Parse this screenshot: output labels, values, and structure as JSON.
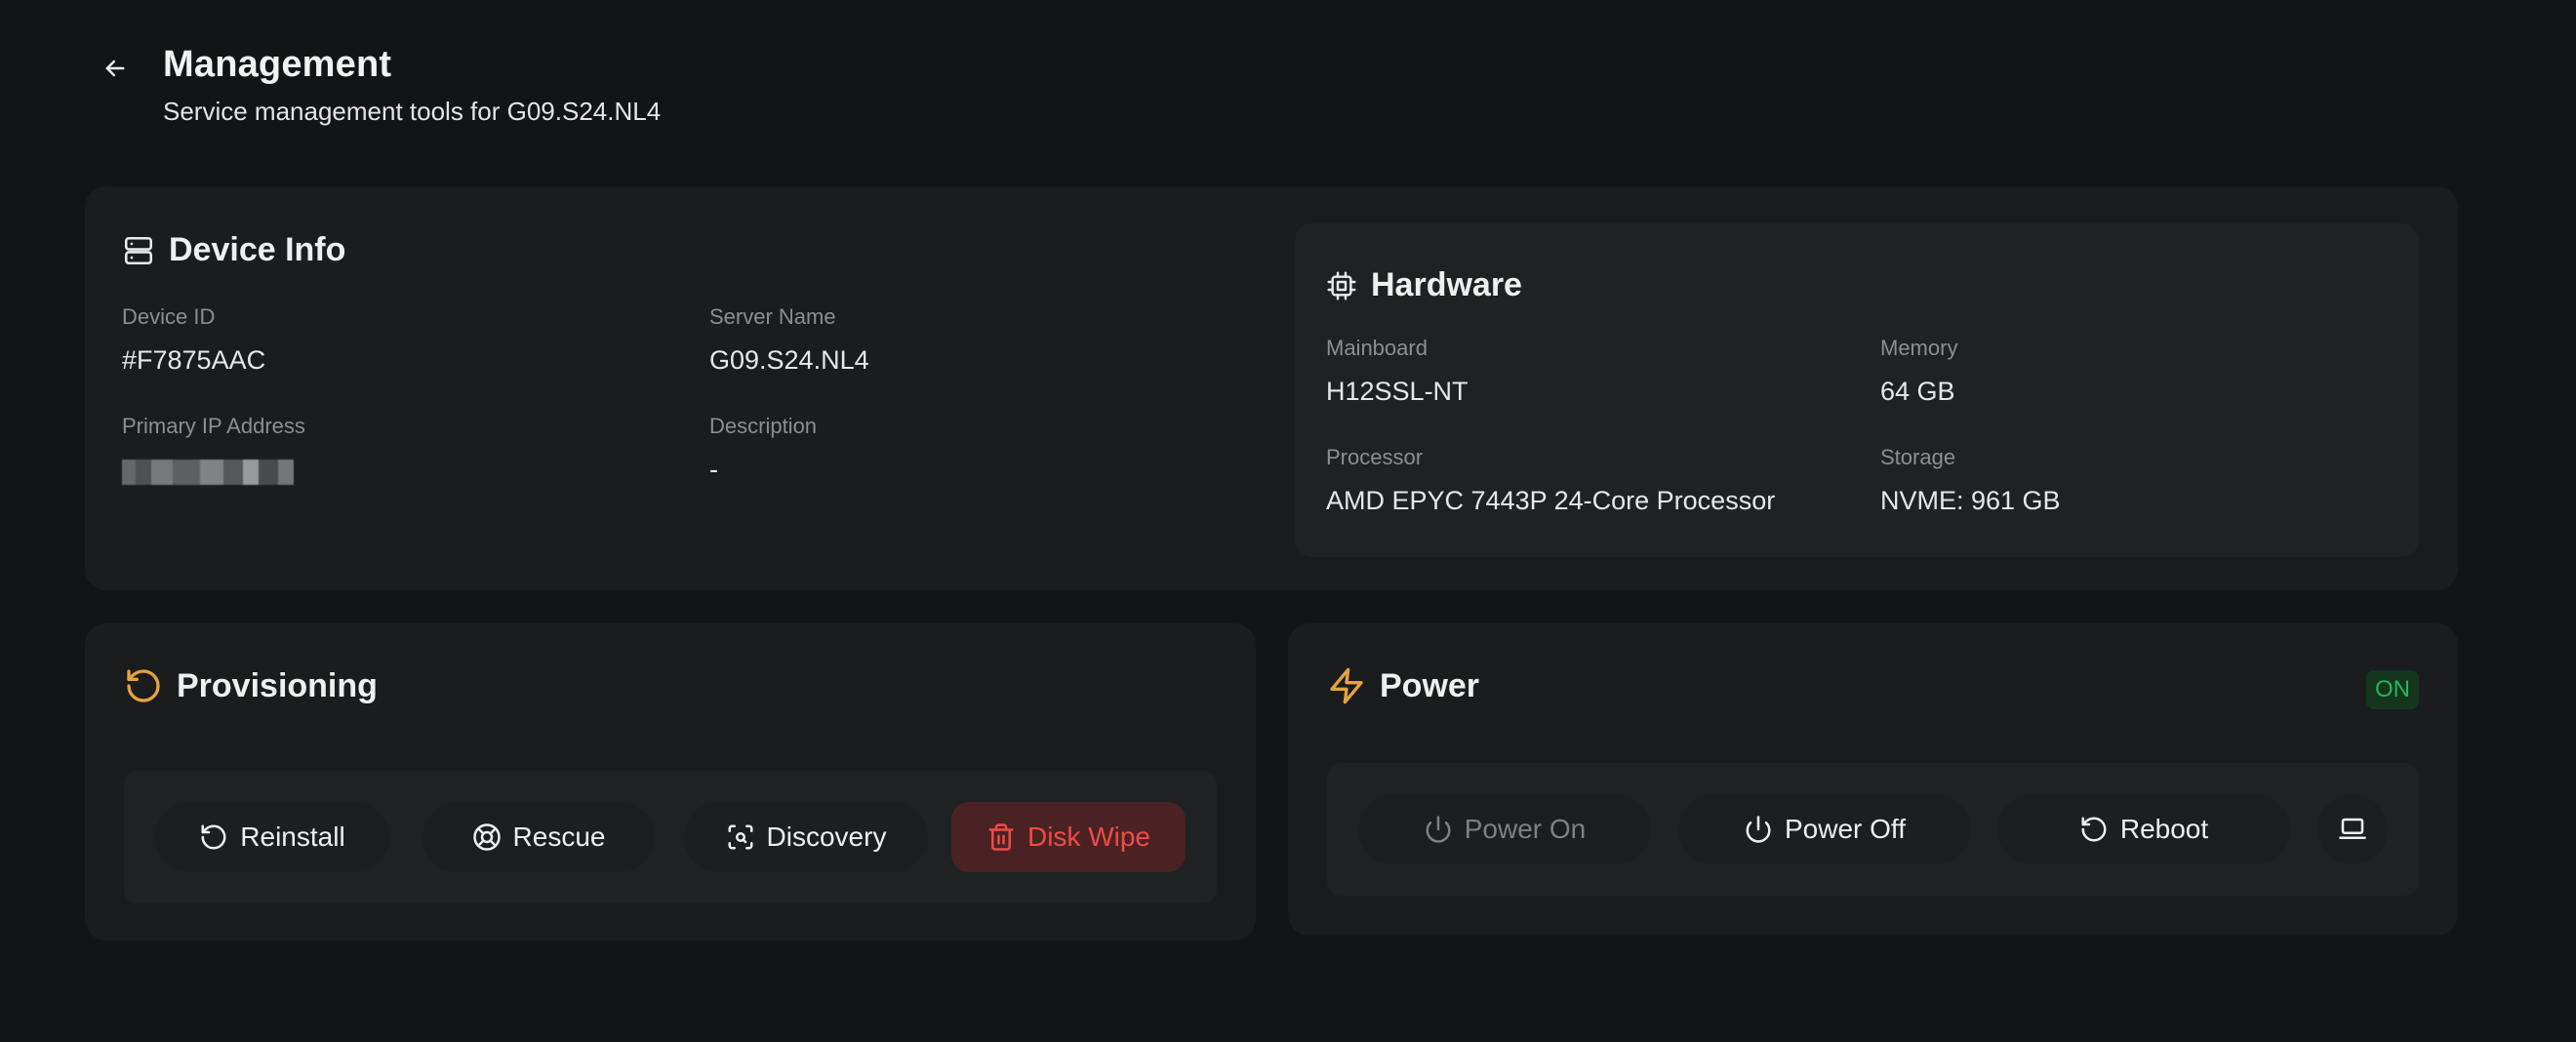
{
  "header": {
    "title": "Management",
    "subtitle": "Service management tools for G09.S24.NL4"
  },
  "device_info": {
    "title": "Device Info",
    "fields": {
      "device_id": {
        "label": "Device ID",
        "value": "#F7875AAC"
      },
      "server_name": {
        "label": "Server Name",
        "value": "G09.S24.NL4"
      },
      "primary_ip": {
        "label": "Primary IP Address"
      },
      "description": {
        "label": "Description",
        "value": "-"
      }
    }
  },
  "hardware": {
    "title": "Hardware",
    "fields": {
      "mainboard": {
        "label": "Mainboard",
        "value": "H12SSL-NT"
      },
      "memory": {
        "label": "Memory",
        "value": "64 GB"
      },
      "processor": {
        "label": "Processor",
        "value": "AMD EPYC 7443P 24-Core Processor"
      },
      "storage": {
        "label": "Storage",
        "value": "NVME: 961 GB"
      }
    }
  },
  "provisioning": {
    "title": "Provisioning",
    "buttons": {
      "reinstall": "Reinstall",
      "rescue": "Rescue",
      "discovery": "Discovery",
      "disk_wipe": "Disk Wipe"
    }
  },
  "power": {
    "title": "Power",
    "status": "ON",
    "buttons": {
      "power_on": "Power On",
      "power_off": "Power Off",
      "reboot": "Reboot"
    }
  },
  "colors": {
    "background": "#121516",
    "card": "#1a1c1e",
    "accent_provisioning": "#e6a23c",
    "danger": "#ef4b48",
    "status_on": "#2bb35a"
  },
  "icons": {
    "back": "arrow-left-icon",
    "device_info": "server-icon",
    "hardware": "cpu-chip-icon",
    "provisioning": "rotate-ccw-icon",
    "power": "lightning-bolt-icon",
    "console": "laptop-icon"
  }
}
